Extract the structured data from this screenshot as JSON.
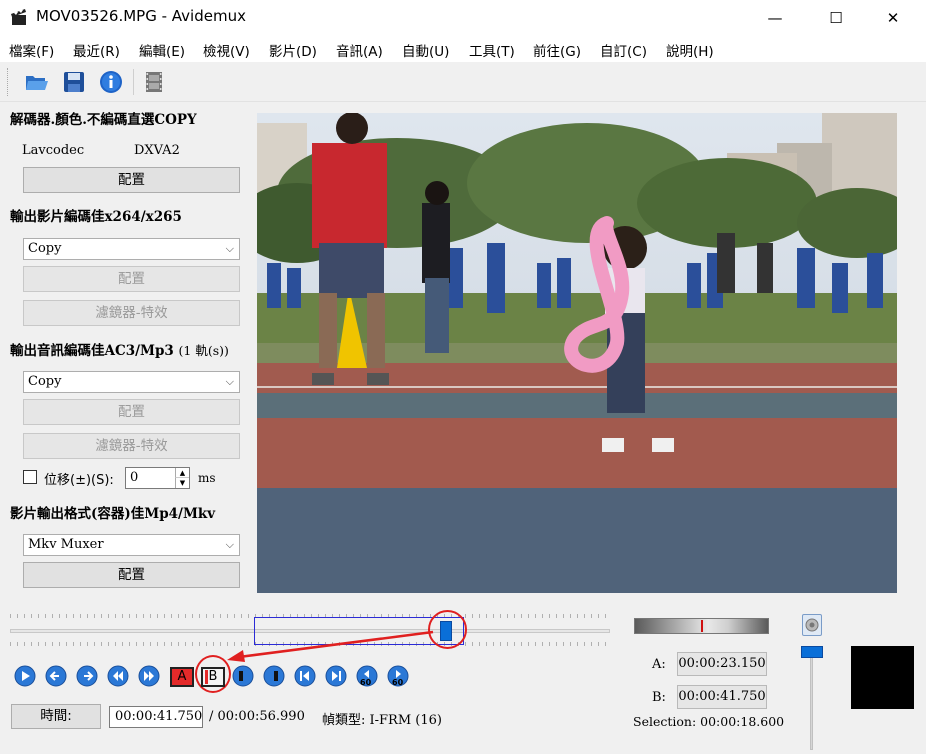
{
  "window": {
    "title": "MOV03526.MPG - Avidemux",
    "minimize": "—",
    "maximize": "☐",
    "close": "✕"
  },
  "menu": [
    "檔案(F)",
    "最近(R)",
    "編輯(E)",
    "檢視(V)",
    "影片(D)",
    "音訊(A)",
    "自動(U)",
    "工具(T)",
    "前往(G)",
    "自訂(C)",
    "說明(H)"
  ],
  "toolbar": {
    "open_icon": "folder-open-icon",
    "save_icon": "floppy-disk-icon",
    "info_icon": "info-icon",
    "film_icon": "film-strip-icon"
  },
  "decoder": {
    "title": "解碼器.顏色.不編碼直選COPY",
    "codec": "Lavcodec",
    "hw": "DXVA2",
    "config_label": "配置"
  },
  "video_output": {
    "title": "輸出影片編碼佳x264/x265",
    "codec": "Copy",
    "config_label": "配置",
    "filters_label": "濾鏡器-特效"
  },
  "audio_output": {
    "title": "輸出音訊編碼佳AC3/Mp3",
    "tracks": "(1 軌(s))",
    "codec": "Copy",
    "config_label": "配置",
    "filters_label": "濾鏡器-特效",
    "shift_label": "位移(±)(S):",
    "shift_value": "0",
    "shift_unit": "ms"
  },
  "container": {
    "title": "影片輸出格式(容器)佳Mp4/Mkv",
    "format": "Mkv Muxer",
    "config_label": "配置"
  },
  "controls": {
    "marker_a": "A",
    "marker_b": "B",
    "frame_badge": "60"
  },
  "status": {
    "time_button": "時間:",
    "current_time": "00:00:41.750",
    "total_time": "/ 00:00:56.990",
    "frame_type": "幀類型: I-FRM (16)",
    "a_label": "A:",
    "a_time": "00:00:23.150",
    "b_label": "B:",
    "b_time": "00:00:41.750",
    "selection": "Selection: 00:00:18.600"
  },
  "colors": {
    "accent_blue": "#0a6fd8",
    "annotation_red": "#e02020"
  }
}
